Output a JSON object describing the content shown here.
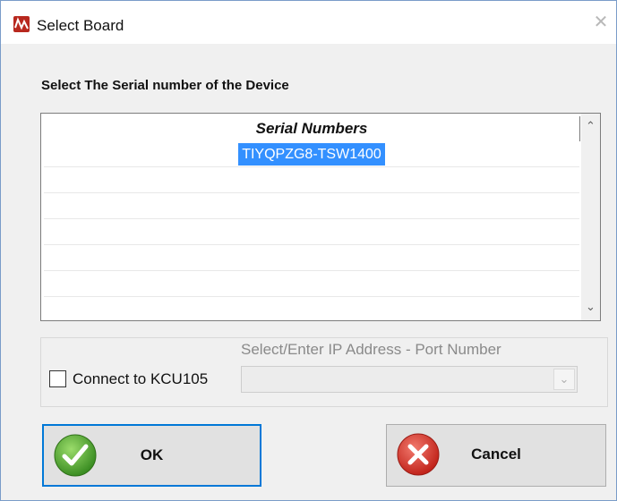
{
  "window": {
    "title": "Select Board"
  },
  "instruction": "Select The Serial number of the Device",
  "grid": {
    "header": "Serial Numbers",
    "rows": [
      "TIYQPZG8-TSW1400",
      "",
      "",
      "",
      "",
      "",
      ""
    ],
    "selected_index": 0
  },
  "connection": {
    "ip_label": "Select/Enter IP Address - Port Number",
    "checkbox_label": "Connect to KCU105",
    "checkbox_checked": false,
    "ip_value": ""
  },
  "buttons": {
    "ok": "OK",
    "cancel": "Cancel"
  },
  "icons": {
    "app": "app-logo-icon",
    "close": "close-icon",
    "scroll_up": "chevron-up-icon",
    "scroll_down": "chevron-down-icon",
    "dropdown": "chevron-down-icon",
    "ok": "checkmark-icon",
    "cancel": "x-icon"
  },
  "colors": {
    "selection": "#3390ff",
    "focus_border": "#0078d7",
    "ok_green": "#4caf30",
    "cancel_red": "#d9352c"
  }
}
